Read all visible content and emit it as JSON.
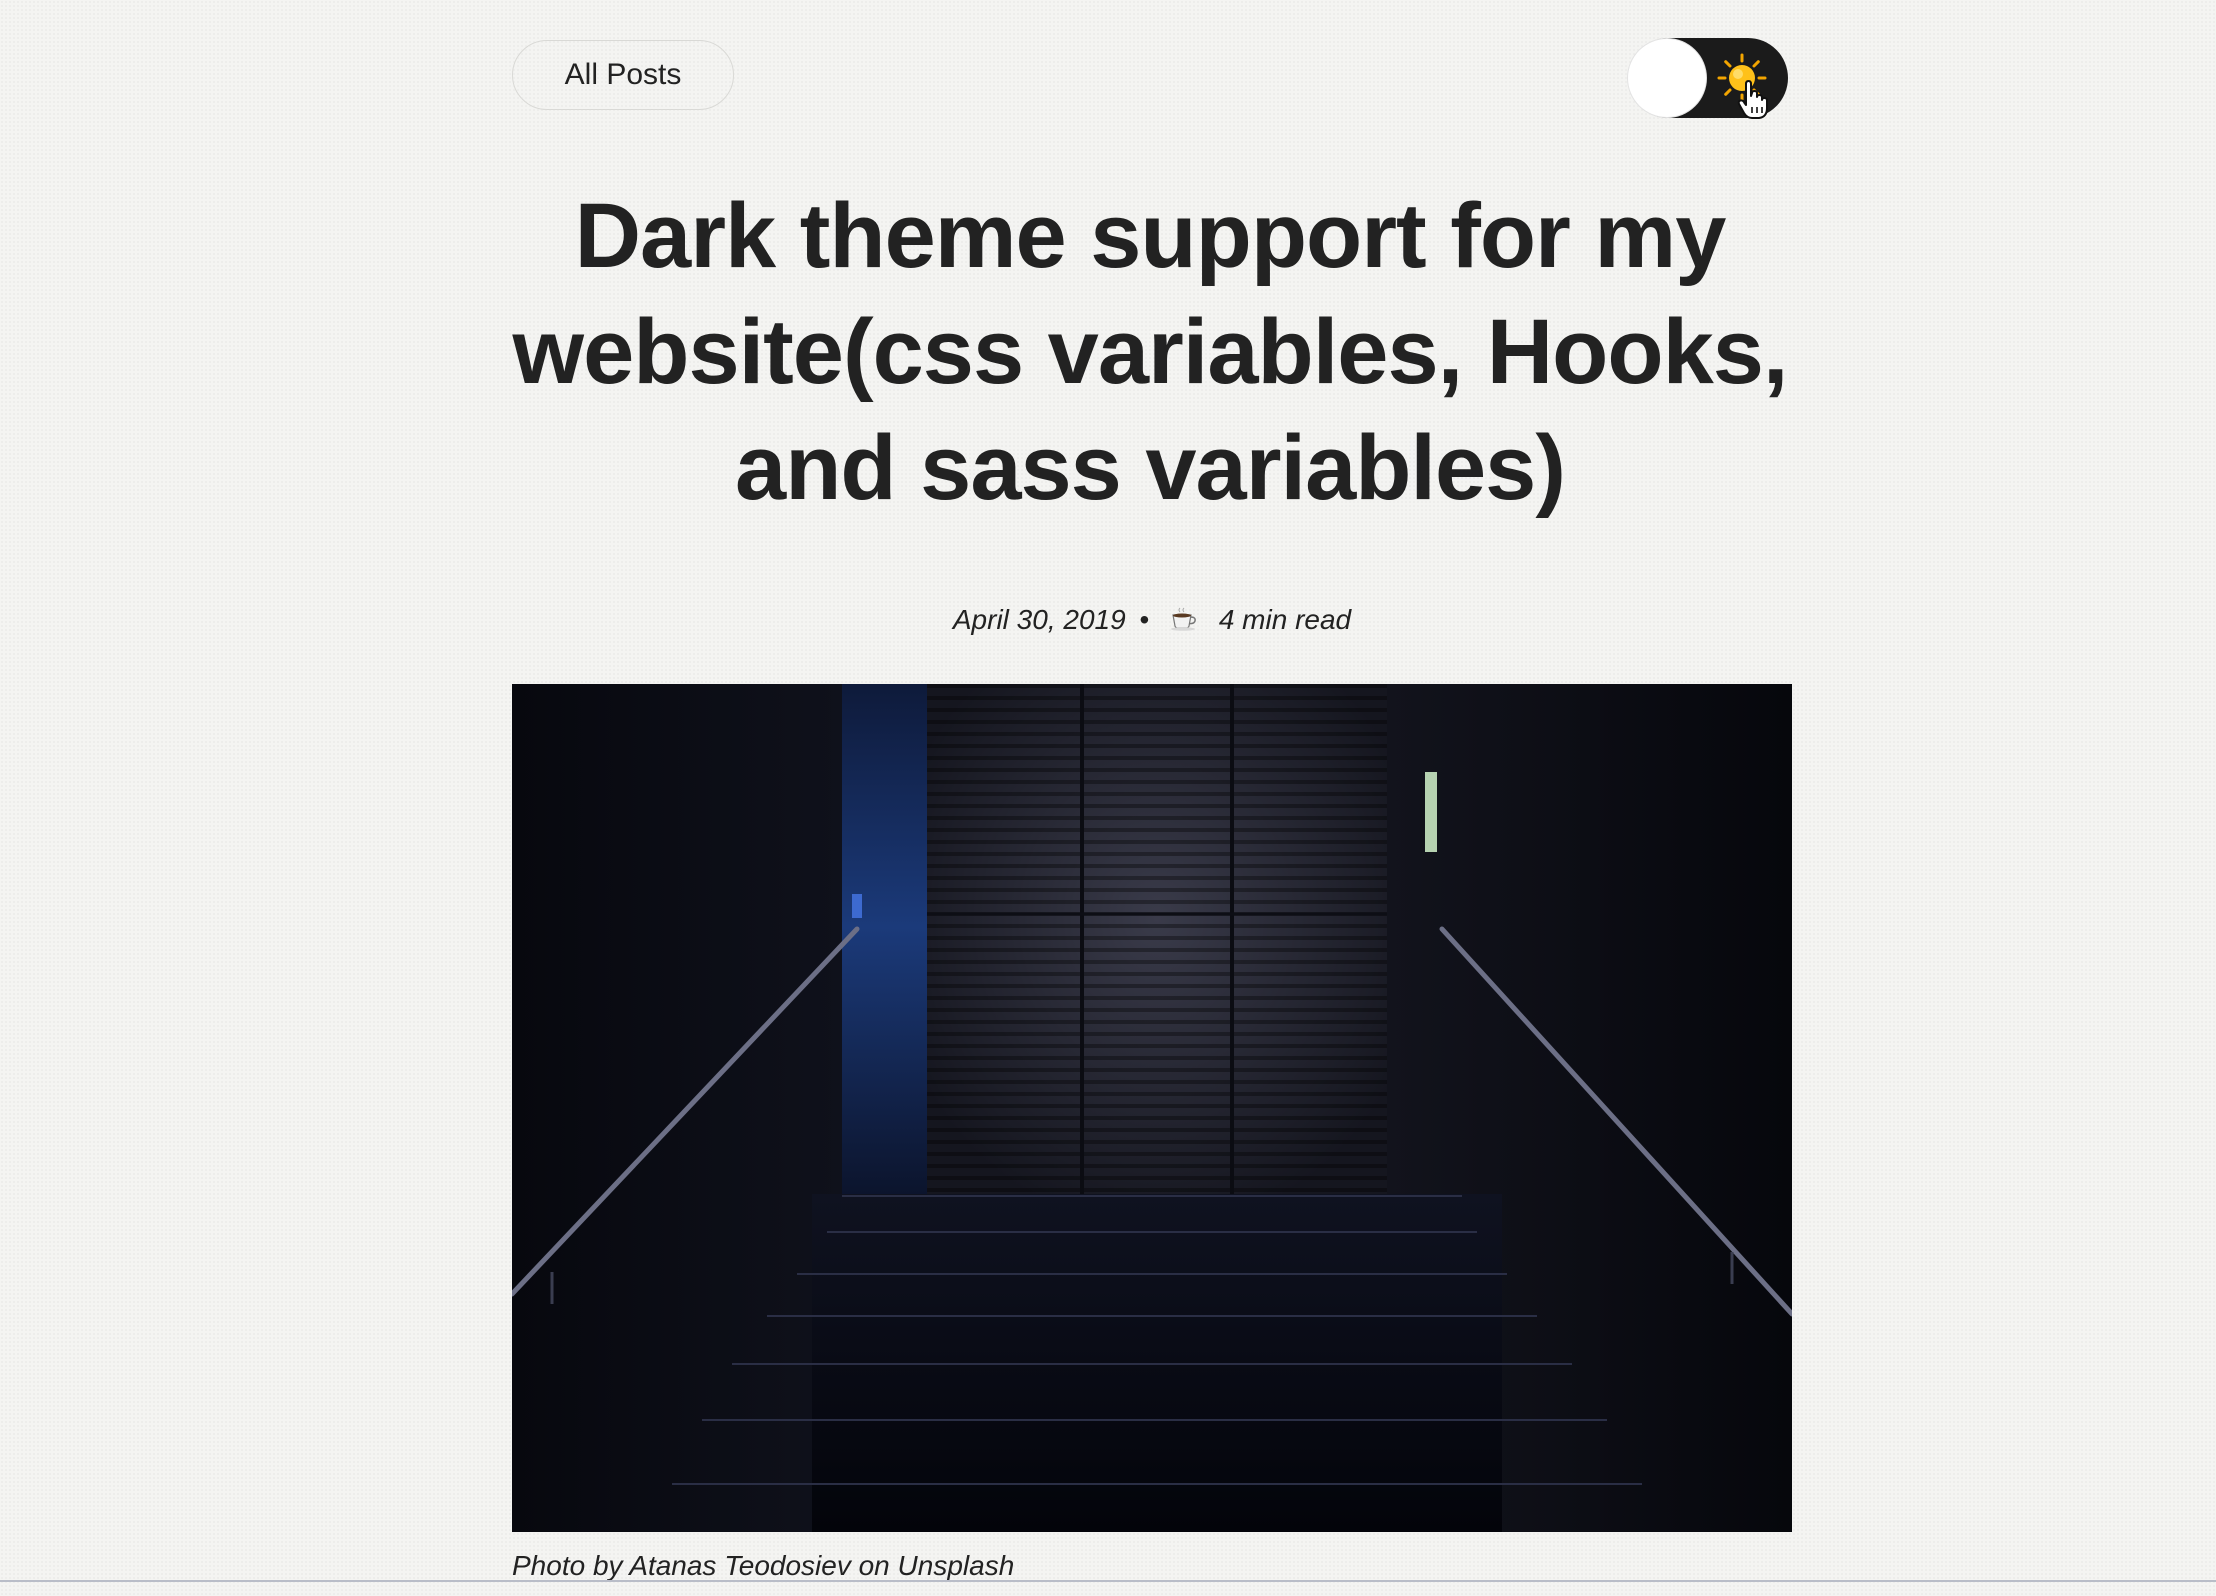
{
  "nav": {
    "all_posts_label": "All Posts"
  },
  "theme_toggle": {
    "state": "light",
    "icon": "sun-icon"
  },
  "post": {
    "title": "Dark theme support for my website(css variables, Hooks, and sass variables)",
    "date": "April 30, 2019",
    "separator": "•",
    "read_icon": "coffee-icon",
    "read_time": "4 min read",
    "hero_image": "dark staircase with handrails",
    "caption": "Photo by Atanas Teodosiev on Unsplash"
  },
  "colors": {
    "background": "#f4f4f2",
    "text": "#222222",
    "toggle_track": "#1b1b1b",
    "sun": "#f6b500"
  }
}
